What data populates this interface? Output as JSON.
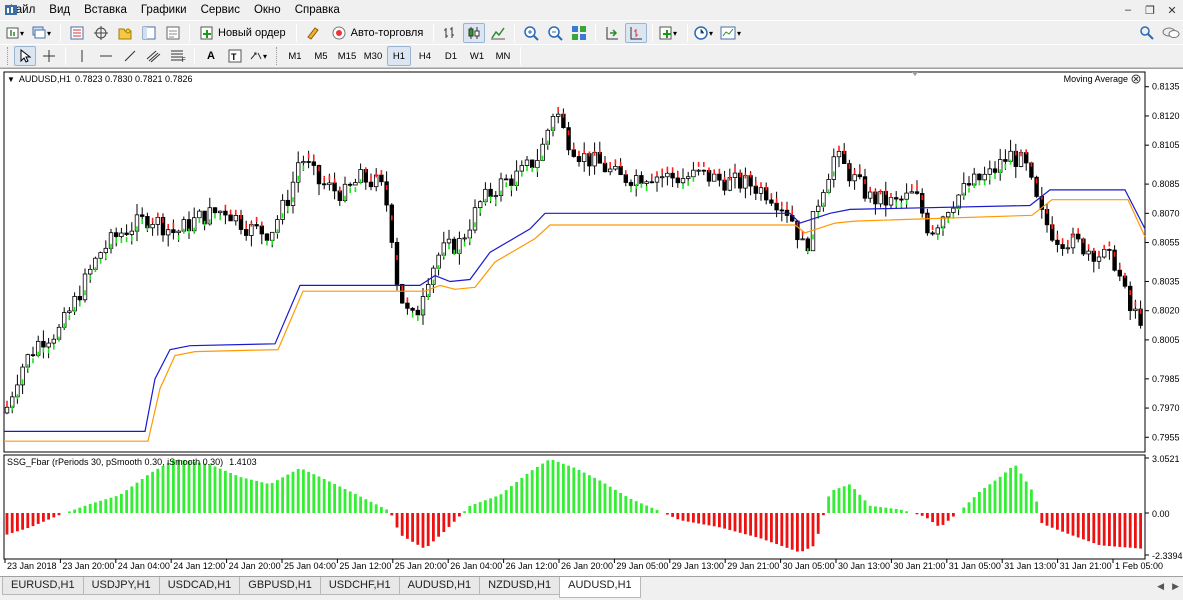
{
  "menu": {
    "items": [
      "Файл",
      "Вид",
      "Вставка",
      "Графики",
      "Сервис",
      "Окно",
      "Справка"
    ]
  },
  "toolbar": {
    "new_order_label": "Новый ордер",
    "autotrading_label": "Авто-торговля",
    "timeframes": [
      "M1",
      "M5",
      "M15",
      "M30",
      "H1",
      "H4",
      "D1",
      "W1",
      "MN"
    ],
    "active_timeframe": "H1"
  },
  "chart": {
    "symbol_info": "AUDUSD,H1",
    "ohlc": "0.7823 0.7830 0.7821 0.7826",
    "indicator_label": "Moving Average",
    "price_labels": [
      "0.8135",
      "0.8120",
      "0.8105",
      "0.8085",
      "0.8070",
      "0.8055",
      "0.8035",
      "0.8020",
      "0.8005",
      "0.7985",
      "0.7970",
      "0.7955"
    ],
    "subwindow": {
      "title": "SSG_Fbar  (rPeriods 30, pSmooth 0.30, iSmooth 0.30)",
      "value": "1.4103",
      "labels": [
        "3.0521",
        "0.00",
        "-2.3394"
      ]
    },
    "time_labels": [
      "23 Jan 2018",
      "23 Jan 20:00",
      "24 Jan 04:00",
      "24 Jan 12:00",
      "24 Jan 20:00",
      "25 Jan 04:00",
      "25 Jan 12:00",
      "25 Jan 20:00",
      "26 Jan 04:00",
      "26 Jan 12:00",
      "26 Jan 20:00",
      "29 Jan 05:00",
      "29 Jan 13:00",
      "29 Jan 21:00",
      "30 Jan 05:00",
      "30 Jan 13:00",
      "30 Jan 21:00",
      "31 Jan 05:00",
      "31 Jan 13:00",
      "31 Jan 21:00",
      "1 Feb 05:00"
    ],
    "colors": {
      "bull": "#20e020",
      "bear": "#ff2020",
      "ma_blue": "#1a1acc",
      "ma_orange": "#ff9900",
      "hist_pos": "#33ee33",
      "hist_neg": "#ee1111"
    }
  },
  "tabs": [
    "EURUSD,H1",
    "USDJPY,H1",
    "USDCAD,H1",
    "GBPUSD,H1",
    "USDCHF,H1",
    "AUDUSD,H1",
    "NZDUSD,H1",
    "AUDUSD,H1"
  ],
  "active_tab_index": 7
}
